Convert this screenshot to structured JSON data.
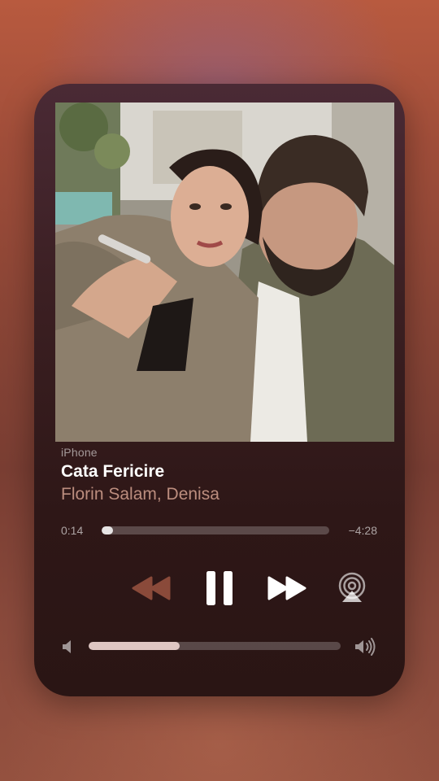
{
  "now_playing": {
    "source": "iPhone",
    "title": "Cata Fericire",
    "artist": "Florin Salam, Denisa",
    "elapsed": "0:14",
    "remaining": "−4:28",
    "progress_fraction": 0.05,
    "volume_fraction": 0.36
  },
  "controls": {
    "rewind_icon": "rewind-icon",
    "pause_icon": "pause-icon",
    "forward_icon": "fast-forward-icon",
    "airplay_icon": "airplay-icon",
    "volume_low_icon": "speaker-low-icon",
    "volume_high_icon": "speaker-high-icon"
  },
  "colors": {
    "accent_artist": "#e8b4a0",
    "rewind_dim": "#8a4a3a"
  }
}
